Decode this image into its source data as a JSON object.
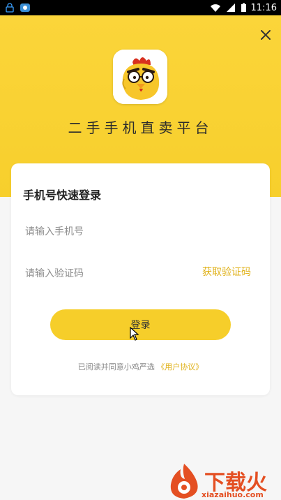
{
  "status_bar": {
    "time": "11:16",
    "icons": [
      "lock-icon",
      "app-icon",
      "wifi-icon",
      "signal-icon",
      "battery-icon"
    ]
  },
  "header": {
    "app_title": "二手手机直卖平台",
    "close_icon": "close-icon",
    "logo": "chicken-mascot-logo"
  },
  "login": {
    "title": "手机号快速登录",
    "phone_placeholder": "请输入手机号",
    "code_placeholder": "请输入验证码",
    "get_code_label": "获取验证码",
    "submit_label": "登录",
    "agreement_text": "已阅读并同意小鸡严选",
    "agreement_link": "《用户协议》"
  },
  "watermark": {
    "brand": "下载火",
    "site": "xiazaihuo.com"
  },
  "colors": {
    "brand_yellow": "#f6ce2a",
    "link_yellow": "#e0b21a",
    "watermark_red": "#e44f22"
  }
}
